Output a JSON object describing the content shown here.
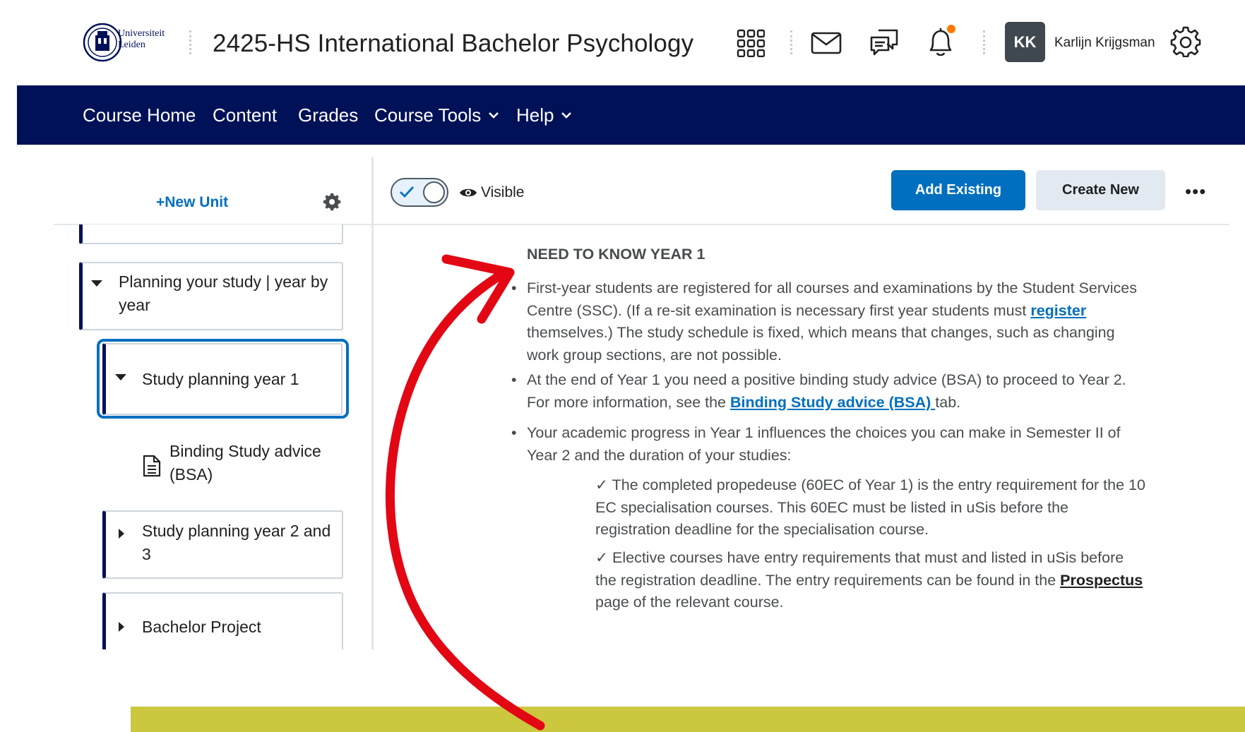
{
  "header": {
    "university_line1": "Universiteit",
    "university_line2": "Leiden",
    "course_title": "2425-HS International Bachelor Psychology",
    "icons": [
      "waffle-icon",
      "mail-icon",
      "chat-icon",
      "bell-icon",
      "gear-icon"
    ],
    "user_initials": "KK",
    "user_name": "Karlijn Krijgsman",
    "notification_color": "#ff7a00"
  },
  "nav": {
    "items": [
      "Course Home",
      "Content",
      "Grades",
      "Course Tools",
      "Help"
    ],
    "background": "#001158"
  },
  "sidebar": {
    "new_unit": "New Unit",
    "new_unit_prefix": "+",
    "items": [
      {
        "label": "Planning your study | year by year",
        "expanded": true
      },
      {
        "label": "Study planning year 1",
        "expanded": true,
        "selected": true
      },
      {
        "label": "Binding Study advice (BSA)",
        "type": "document"
      },
      {
        "label": "Study planning year 2 and 3",
        "expanded": false
      },
      {
        "label": "Bachelor Project",
        "expanded": false
      }
    ]
  },
  "toolbar": {
    "visibility_label": "Visible",
    "visibility_on": true,
    "add_existing": "Add Existing",
    "create_new": "Create New",
    "more": "•••"
  },
  "content": {
    "heading": "NEED TO KNOW YEAR 1",
    "bullet1": {
      "part1": "First-year students are registered for all courses and examinations by the Student Services Centre (SSC). (If a re-sit examination is necessary first year students must ",
      "link": "register ",
      "part2": "themselves.)  The study schedule is fixed, which means that changes, such as changing work group sections, are not possible."
    },
    "bullet2": {
      "part1": "At the end of Year 1 you need a positive binding study advice (BSA) to proceed to Year 2. For more information, see the ",
      "link": "Binding Study advice (BSA) ",
      "part2": "tab."
    },
    "bullet3": "Your academic progress in Year 1 influences the choices you can make in Semester II of Year 2 and the duration of your studies:",
    "check1": {
      "mark": "✓",
      "text": " The completed propedeuse (60EC of Year 1) is the entry requirement for the 10 EC specialisation courses.  This 60EC must be listed in uSis before the registration deadline for the specialisation course."
    },
    "check2": {
      "mark": "✓",
      "text": " Elective courses have entry requirements that must and listed in uSis before the registration deadline. The entry requirements can be found in the ",
      "link": "Prospectus ",
      "tail": "page of the relevant course."
    }
  },
  "annotation": {
    "arrow_color": "#e30613",
    "band_color": "#cbc73f"
  }
}
